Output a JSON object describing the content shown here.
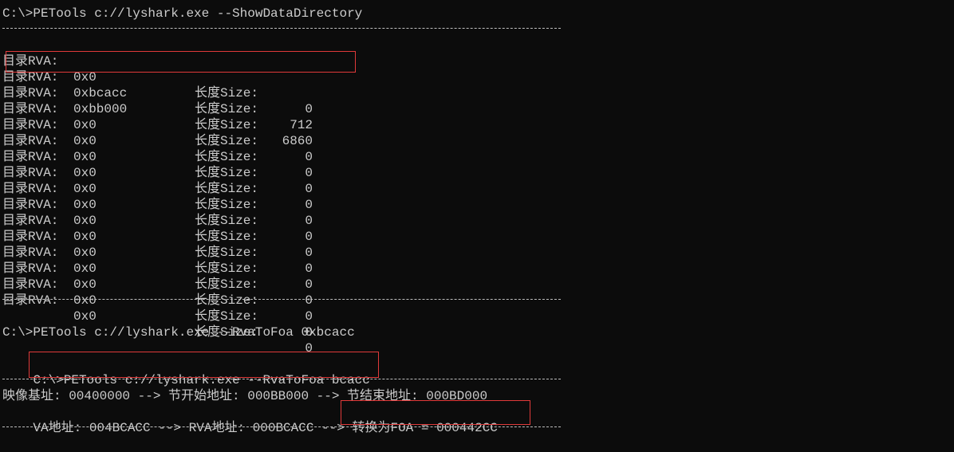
{
  "terminal": {
    "command_1": "C:\\>PETools c://lyshark.exe --ShowDataDirectory",
    "directory_label": "目录RVA:",
    "size_label": "长度Size:",
    "directory_rows": [
      {
        "rva": "0x0",
        "size": "0"
      },
      {
        "rva": "0xbcacc",
        "size": "712"
      },
      {
        "rva": "0xbb000",
        "size": "6860"
      },
      {
        "rva": "0x0",
        "size": "0"
      },
      {
        "rva": "0x0",
        "size": "0"
      },
      {
        "rva": "0x0",
        "size": "0"
      },
      {
        "rva": "0x0",
        "size": "0"
      },
      {
        "rva": "0x0",
        "size": "0"
      },
      {
        "rva": "0x0",
        "size": "0"
      },
      {
        "rva": "0x0",
        "size": "0"
      },
      {
        "rva": "0x0",
        "size": "0"
      },
      {
        "rva": "0x0",
        "size": "0"
      },
      {
        "rva": "0x0",
        "size": "0"
      },
      {
        "rva": "0x0",
        "size": "0"
      },
      {
        "rva": "0x0",
        "size": "0"
      },
      {
        "rva": "0x0",
        "size": "0"
      }
    ],
    "command_2": "C:\\>PETools c://lyshark.exe --RvaToFoa 0xbcacc",
    "prompt_3": "C:\\>",
    "command_3": "PETools c://lyshark.exe --RvaToFoa bcacc",
    "result_line_1": "映像基址: 00400000 --> 节开始地址: 000BB000 --> 节结束地址: 000BD000",
    "result_line_2_prefix": "VA地址: 004BCACC --> RVA地址: 000BCACC --> ",
    "result_line_2_foa": "转换为FOA = 000442CC"
  },
  "colors": {
    "background": "#0c0c0c",
    "text": "#cccccc",
    "highlight_box": "#e03a3a"
  }
}
